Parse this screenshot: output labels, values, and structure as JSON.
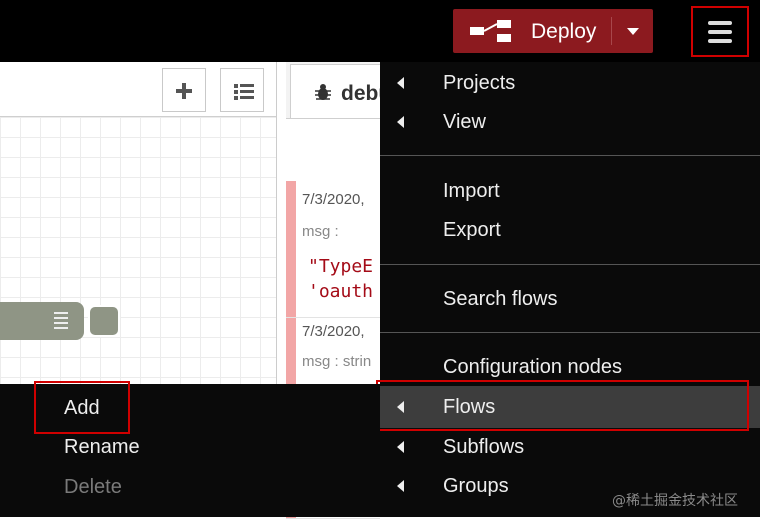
{
  "header": {
    "deploy_label": "Deploy",
    "deploy_icon": "deploy-icon",
    "menu_icon": "hamburger-icon",
    "deploy_color": "#8c1a1f"
  },
  "workspace": {
    "add_flow_icon": "plus-icon",
    "list_flows_icon": "list-icon"
  },
  "sidebar": {
    "tab_label": "debu",
    "tab_icon": "bug-icon",
    "messages": [
      {
        "date": "7/3/2020,",
        "key": "msg :",
        "lines": [
          "\"TypeE",
          "'oauth"
        ]
      },
      {
        "date": "7/3/2020,",
        "key": "msg : strin"
      }
    ]
  },
  "main_menu": {
    "items": [
      {
        "label": "Projects",
        "submenu": true
      },
      {
        "label": "View",
        "submenu": true
      },
      {
        "label": "Import",
        "submenu": false
      },
      {
        "label": "Export",
        "submenu": false
      },
      {
        "label": "Search flows",
        "submenu": false
      },
      {
        "label": "Configuration nodes",
        "submenu": false
      },
      {
        "label": "Flows",
        "submenu": true,
        "active": true
      },
      {
        "label": "Subflows",
        "submenu": true
      },
      {
        "label": "Groups",
        "submenu": true
      }
    ]
  },
  "context_menu": {
    "items": [
      {
        "label": "Add",
        "enabled": true
      },
      {
        "label": "Rename",
        "enabled": true
      },
      {
        "label": "Delete",
        "enabled": false
      }
    ]
  },
  "watermark": "@稀土掘金技术社区",
  "colors": {
    "highlight": "#d00000",
    "error_text": "#a40b17"
  }
}
